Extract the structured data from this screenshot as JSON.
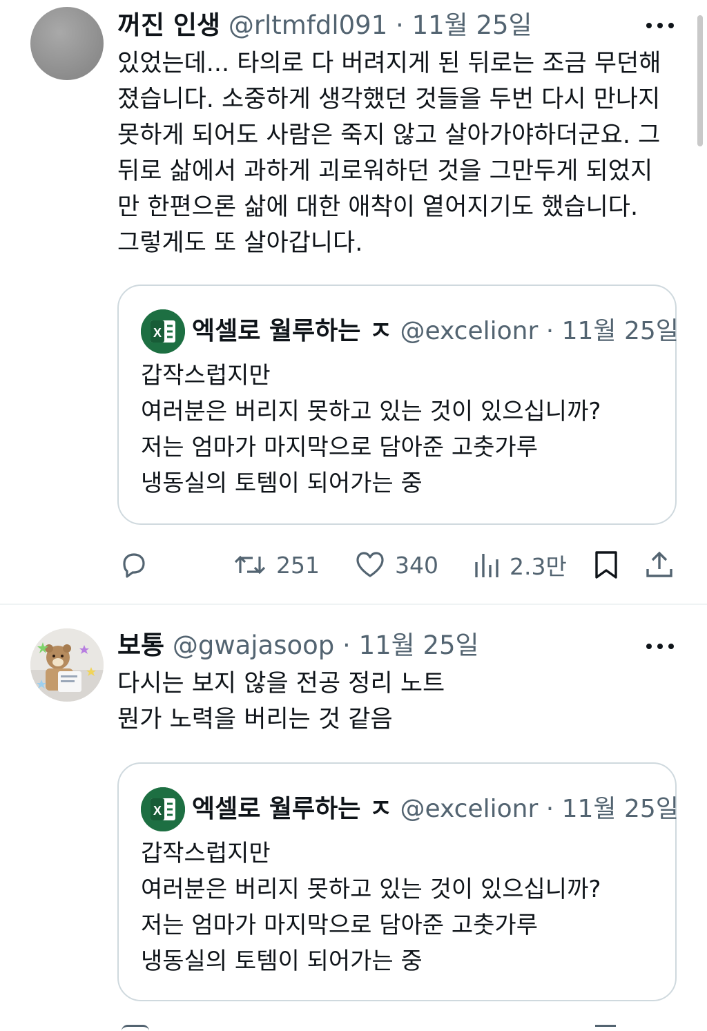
{
  "tweets": [
    {
      "author_name": "꺼진 인생",
      "handle": "@rltmfdl091",
      "separator": "·",
      "date": "11월 25일",
      "text_lines": [
        "있었는데... 타의로 다 버려지게 된 뒤로는 조금 무던해",
        "졌습니다. 소중하게 생각했던 것들을 두번 다시 만나지",
        "못하게 되어도 사람은 죽지 않고 살아가야하더군요. 그",
        "뒤로 삶에서 과하게 괴로워하던 것을 그만두게 되었지",
        "만 한편으론 삶에 대한 애착이 옅어지기도 했습니다.",
        "그렇게도 또 살아갑니다."
      ],
      "quote": {
        "author_name": "엑셀로 월루하는 ㅈ",
        "handle": "@excelionr",
        "separator": "·",
        "date": "11월 25일",
        "text_lines": [
          "갑작스럽지만",
          "여러분은 버리지 못하고 있는 것이 있으십니까?",
          "저는 엄마가 마지막으로 담아준 고춧가루",
          "냉동실의 토템이 되어가는 중"
        ]
      },
      "actions": {
        "retweets": "251",
        "likes": "340",
        "views": "2.3만"
      }
    },
    {
      "author_name": "보통",
      "handle": "@gwajasoop",
      "separator": "·",
      "date": "11월 25일",
      "text_lines": [
        "다시는 보지 않을 전공 정리 노트",
        "뭔가 노력을 버리는 것 같음"
      ],
      "quote": {
        "author_name": "엑셀로 월루하는 ㅈ",
        "handle": "@excelionr",
        "separator": "·",
        "date": "11월 25일",
        "text_lines": [
          "갑작스럽지만",
          "여러분은 버리지 못하고 있는 것이 있으십니까?",
          "저는 엄마가 마지막으로 담아준 고춧가루",
          "냉동실의 토템이 되어가는 중"
        ]
      }
    }
  ],
  "icons": {
    "reply": "reply-icon",
    "retweet": "retweet-icon",
    "like": "heart-icon",
    "views": "views-bar-chart-icon",
    "bookmark": "bookmark-icon",
    "share": "share-icon",
    "more": "more-dots-icon"
  },
  "colors": {
    "text_primary": "#0f1419",
    "text_secondary": "#536471",
    "border": "#cfd9de",
    "excel_green": "#1d6f42"
  }
}
